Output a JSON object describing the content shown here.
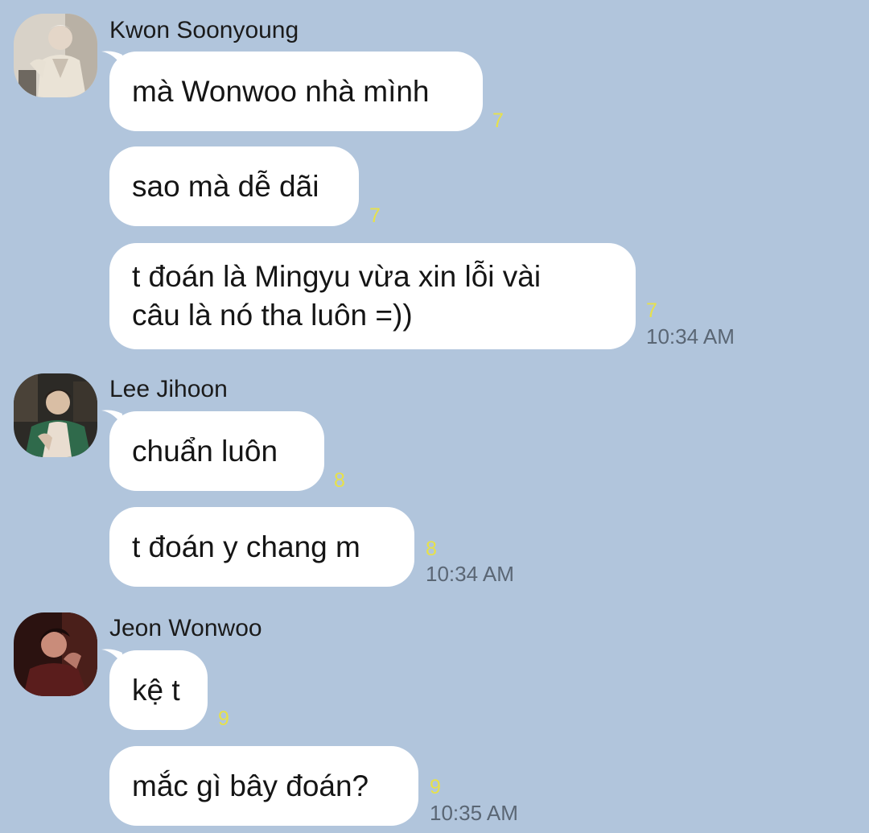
{
  "groups": [
    {
      "sender": "Kwon Soonyoung",
      "avatar": "kwon-soonyoung-avatar",
      "messages": [
        {
          "text": "mà Wonwoo nhà mình",
          "read_count": "7"
        },
        {
          "text": "sao mà dễ dãi",
          "read_count": "7"
        },
        {
          "text": "t đoán là Mingyu vừa xin lỗi vài\ncâu là nó tha luôn =))",
          "read_count": "7",
          "time": "10:34 AM"
        }
      ]
    },
    {
      "sender": "Lee Jihoon",
      "avatar": "lee-jihoon-avatar",
      "messages": [
        {
          "text": "chuẩn luôn",
          "read_count": "8"
        },
        {
          "text": "t đoán y chang m",
          "read_count": "8",
          "time": "10:34 AM"
        }
      ]
    },
    {
      "sender": "Jeon Wonwoo",
      "avatar": "jeon-wonwoo-avatar",
      "messages": [
        {
          "text": "kệ t",
          "read_count": "9"
        },
        {
          "text": "mắc gì bây đoán?",
          "read_count": "9",
          "time": "10:35 AM"
        }
      ]
    }
  ],
  "colors": {
    "background": "#b1c5dc",
    "bubble": "#ffffff",
    "read_count": "#e7e14a",
    "timestamp": "#5a6674"
  }
}
